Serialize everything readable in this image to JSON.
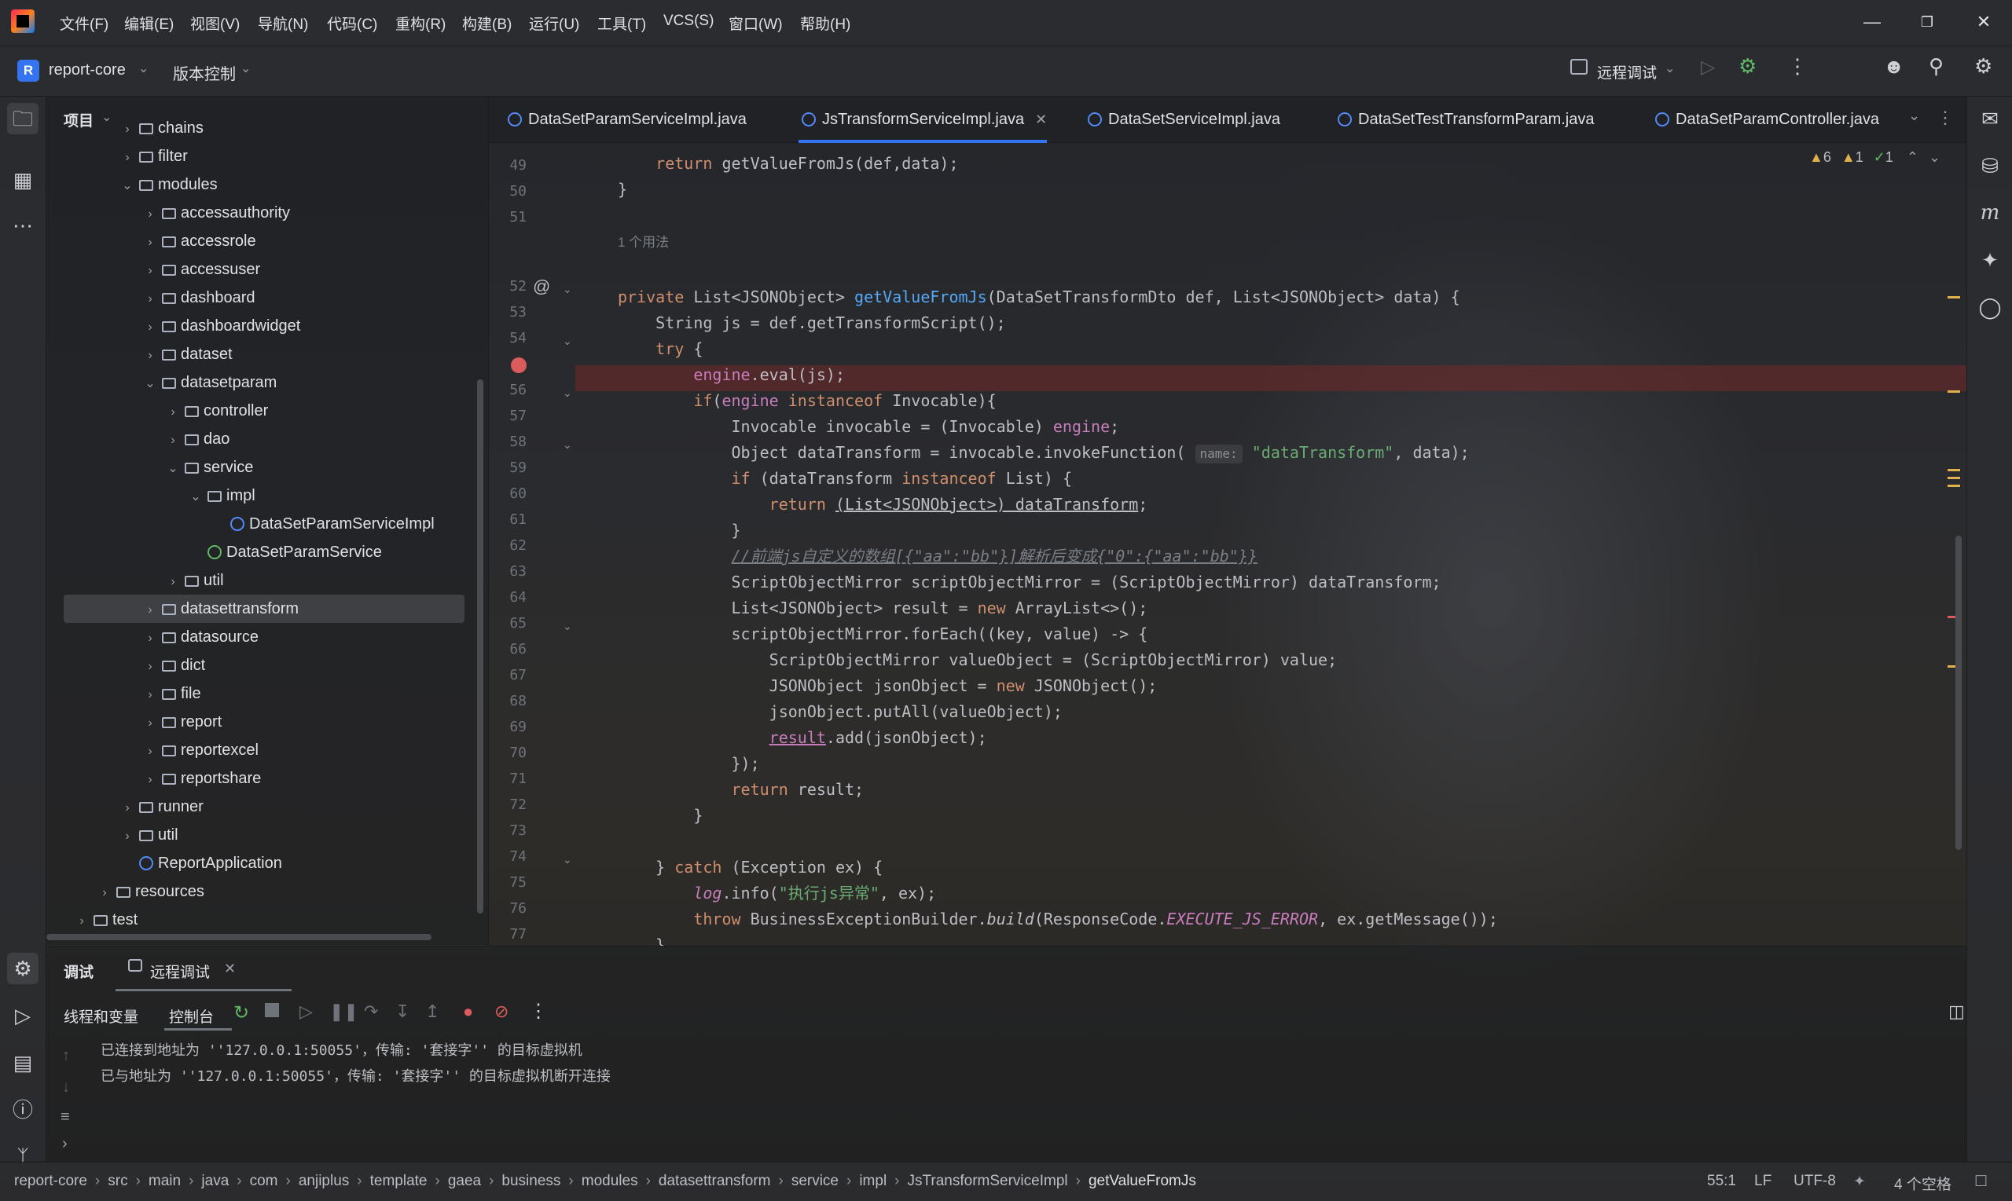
{
  "menubar": {
    "items": [
      "文件(F)",
      "编辑(E)",
      "视图(V)",
      "导航(N)",
      "代码(C)",
      "重构(R)",
      "构建(B)",
      "运行(U)",
      "工具(T)",
      "VCS(S)",
      "窗口(W)",
      "帮助(H)"
    ]
  },
  "toolbar": {
    "project_badge": "R",
    "project_name": "report-core",
    "vcs_label": "版本控制",
    "run_config": "远程调试"
  },
  "project_panel": {
    "title": "项目",
    "tree": [
      {
        "label": "chains",
        "indent": 0,
        "type": "folder",
        "state": "collapsed"
      },
      {
        "label": "filter",
        "indent": 0,
        "type": "folder",
        "state": "collapsed"
      },
      {
        "label": "modules",
        "indent": 0,
        "type": "folder",
        "state": "expanded"
      },
      {
        "label": "accessauthority",
        "indent": 1,
        "type": "folder",
        "state": "collapsed"
      },
      {
        "label": "accessrole",
        "indent": 1,
        "type": "folder",
        "state": "collapsed"
      },
      {
        "label": "accessuser",
        "indent": 1,
        "type": "folder",
        "state": "collapsed"
      },
      {
        "label": "dashboard",
        "indent": 1,
        "type": "folder",
        "state": "collapsed"
      },
      {
        "label": "dashboardwidget",
        "indent": 1,
        "type": "folder",
        "state": "collapsed"
      },
      {
        "label": "dataset",
        "indent": 1,
        "type": "folder",
        "state": "collapsed"
      },
      {
        "label": "datasetparam",
        "indent": 1,
        "type": "folder",
        "state": "expanded"
      },
      {
        "label": "controller",
        "indent": 2,
        "type": "folder",
        "state": "collapsed"
      },
      {
        "label": "dao",
        "indent": 2,
        "type": "folder",
        "state": "collapsed"
      },
      {
        "label": "service",
        "indent": 2,
        "type": "folder",
        "state": "expanded"
      },
      {
        "label": "impl",
        "indent": 3,
        "type": "folder",
        "state": "expanded"
      },
      {
        "label": "DataSetParamServiceImpl",
        "indent": 4,
        "type": "class",
        "state": "leaf"
      },
      {
        "label": "DataSetParamService",
        "indent": 3,
        "type": "interface",
        "state": "leaf"
      },
      {
        "label": "util",
        "indent": 2,
        "type": "folder",
        "state": "collapsed"
      },
      {
        "label": "datasettransform",
        "indent": 1,
        "type": "folder",
        "state": "collapsed",
        "selected": true
      },
      {
        "label": "datasource",
        "indent": 1,
        "type": "folder",
        "state": "collapsed"
      },
      {
        "label": "dict",
        "indent": 1,
        "type": "folder",
        "state": "collapsed"
      },
      {
        "label": "file",
        "indent": 1,
        "type": "folder",
        "state": "collapsed"
      },
      {
        "label": "report",
        "indent": 1,
        "type": "folder",
        "state": "collapsed"
      },
      {
        "label": "reportexcel",
        "indent": 1,
        "type": "folder",
        "state": "collapsed"
      },
      {
        "label": "reportshare",
        "indent": 1,
        "type": "folder",
        "state": "collapsed"
      },
      {
        "label": "runner",
        "indent": 0,
        "type": "folder",
        "state": "collapsed"
      },
      {
        "label": "util",
        "indent": 0,
        "type": "folder",
        "state": "collapsed"
      },
      {
        "label": "ReportApplication",
        "indent": 0,
        "type": "class",
        "state": "leaf"
      },
      {
        "label": "resources",
        "indent": -1,
        "type": "folder",
        "state": "collapsed"
      },
      {
        "label": "test",
        "indent": -2,
        "type": "folder",
        "state": "collapsed"
      }
    ]
  },
  "tabs": [
    {
      "label": "DataSetParamServiceImpl.java",
      "active": false
    },
    {
      "label": "JsTransformServiceImpl.java",
      "active": true
    },
    {
      "label": "DataSetServiceImpl.java",
      "active": false
    },
    {
      "label": "DataSetTestTransformParam.java",
      "active": false
    },
    {
      "label": "DataSetParamController.java",
      "active": false
    }
  ],
  "inspections": {
    "warnings": "6",
    "weak_warnings": "1",
    "ok": "1"
  },
  "editor": {
    "usage_hint": "1 个用法",
    "param_hint": "name:",
    "line_numbers": [
      "49",
      "50",
      "51",
      "52",
      "53",
      "54",
      "55",
      "56",
      "57",
      "58",
      "59",
      "60",
      "61",
      "62",
      "63",
      "64",
      "65",
      "66",
      "67",
      "68",
      "69",
      "70",
      "71",
      "72",
      "73",
      "74",
      "75",
      "76",
      "77"
    ]
  },
  "debug": {
    "tab_debug": "调试",
    "tab_remote": "远程调试",
    "sub_threads": "线程和变量",
    "sub_console": "控制台",
    "console_lines": [
      "已连接到地址为 ''127.0.0.1:50055'，传输: '套接字'' 的目标虚拟机",
      "已与地址为 ''127.0.0.1:50055'，传输: '套接字'' 的目标虚拟机断开连接"
    ]
  },
  "statusbar": {
    "breadcrumbs": [
      "report-core",
      "src",
      "main",
      "java",
      "com",
      "anjiplus",
      "template",
      "gaea",
      "business",
      "modules",
      "datasettransform",
      "service",
      "impl",
      "JsTransformServiceImpl",
      "getValueFromJs"
    ],
    "position": "55:1",
    "line_sep": "LF",
    "encoding": "UTF-8",
    "indent": "4 个空格"
  }
}
